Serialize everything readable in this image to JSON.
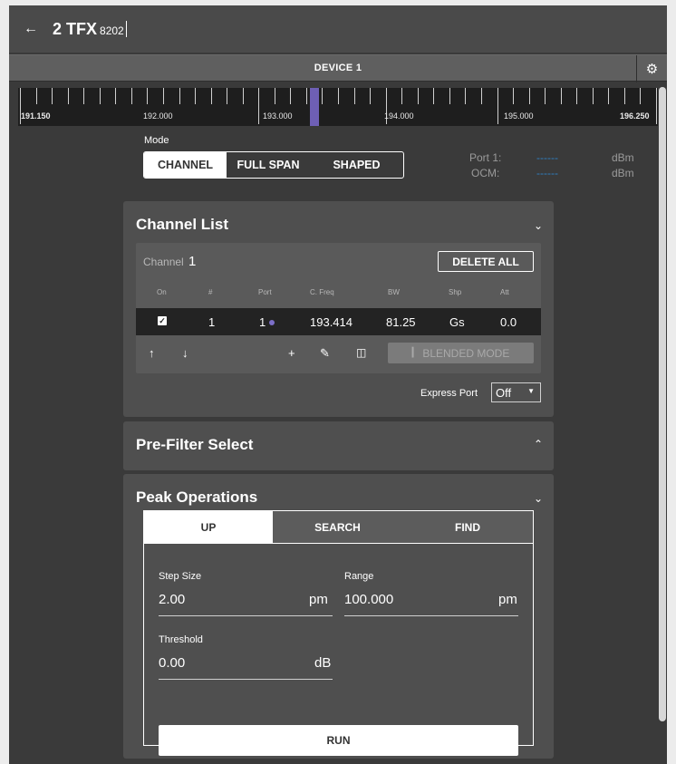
{
  "header": {
    "back_icon": "arrow-left-icon",
    "title": "2 TFX",
    "model": "8202"
  },
  "device_bar": {
    "label": "DEVICE 1",
    "settings_icon": "gear-icon"
  },
  "ruler": {
    "start": "191.150",
    "end": "196.250",
    "labels": [
      "192.000",
      "193.000",
      "194.000",
      "195.000"
    ],
    "marker_color": "#6e5fb5"
  },
  "mode": {
    "label": "Mode",
    "options": [
      "CHANNEL",
      "FULL SPAN",
      "SHAPED"
    ],
    "selected": "CHANNEL"
  },
  "readouts": {
    "port": {
      "label": "Port 1:",
      "value": "------",
      "unit": "dBm"
    },
    "ocm": {
      "label": "OCM:",
      "value": "------",
      "unit": "dBm"
    }
  },
  "channel_list": {
    "title": "Channel List",
    "channel_label": "Channel",
    "channel_number": "1",
    "delete_all": "DELETE ALL",
    "columns": [
      "On",
      "#",
      "Port",
      "C. Freq",
      "BW",
      "Shp",
      "Att"
    ],
    "rows": [
      {
        "on": true,
        "num": "1",
        "port": "1",
        "cfreq": "193.414",
        "bw": "81.25",
        "shp": "Gs",
        "att": "0.0"
      }
    ],
    "toolbar": {
      "up": "↑",
      "down": "↓",
      "add": "+",
      "edit": "✎",
      "delete": "🗑"
    },
    "blended_mode": "BLENDED MODE",
    "express_port_label": "Express Port",
    "express_port_value": "Off"
  },
  "prefilter": {
    "title": "Pre-Filter Select"
  },
  "peak_ops": {
    "title": "Peak Operations",
    "tabs": [
      "UP",
      "SEARCH",
      "FIND"
    ],
    "active_tab": "UP",
    "step_size": {
      "label": "Step Size",
      "value": "2.00",
      "unit": "pm"
    },
    "range": {
      "label": "Range",
      "value": "100.000",
      "unit": "pm"
    },
    "threshold": {
      "label": "Threshold",
      "value": "0.00",
      "unit": "dB"
    },
    "run": "RUN"
  },
  "colors": {
    "accent": "#7c6fc8",
    "dash": "#2f7fc0"
  }
}
